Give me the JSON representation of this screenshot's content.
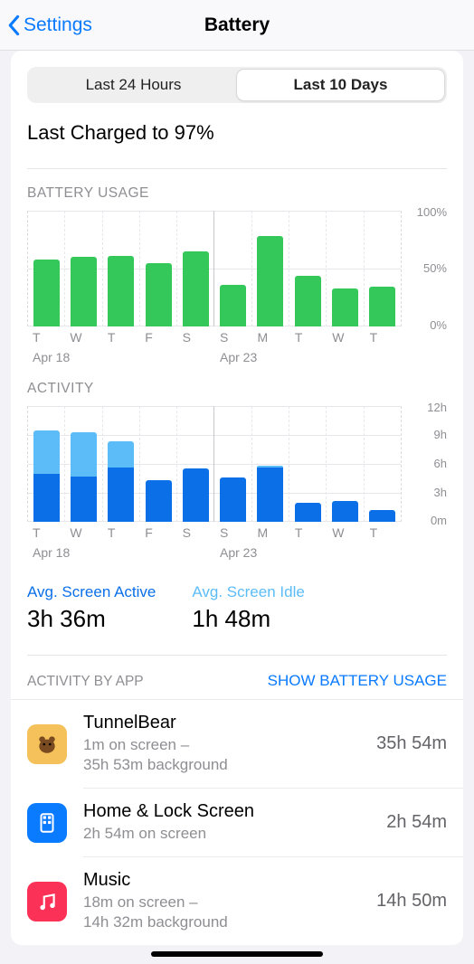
{
  "nav": {
    "back": "Settings",
    "title": "Battery"
  },
  "segmented": {
    "left": "Last 24 Hours",
    "right": "Last 10 Days",
    "active": "right"
  },
  "last_charged": "Last Charged to 97%",
  "section_labels": {
    "battery_usage": "BATTERY USAGE",
    "activity": "ACTIVITY",
    "activity_by_app": "ACTIVITY BY APP"
  },
  "battery_usage_chart": {
    "yaxis": [
      "100%",
      "50%",
      "0%"
    ],
    "xlabels": [
      "T",
      "W",
      "T",
      "F",
      "S",
      "S",
      "M",
      "T",
      "W",
      "T"
    ],
    "date_a": "Apr 18",
    "date_b": "Apr 23"
  },
  "activity_chart": {
    "yaxis": [
      "12h",
      "9h",
      "6h",
      "3h",
      "0m"
    ],
    "xlabels": [
      "T",
      "W",
      "T",
      "F",
      "S",
      "S",
      "M",
      "T",
      "W",
      "T"
    ],
    "date_a": "Apr 18",
    "date_b": "Apr 23"
  },
  "stats": {
    "active_label": "Avg. Screen Active",
    "active_value": "3h 36m",
    "idle_label": "Avg. Screen Idle",
    "idle_value": "1h 48m"
  },
  "show_battery_usage": "SHOW BATTERY USAGE",
  "apps": [
    {
      "name": "TunnelBear",
      "sub": "1m on screen –\n35h 53m background",
      "time": "35h 54m",
      "icon_bg": "#f4c15a",
      "icon_key": "bear"
    },
    {
      "name": "Home & Lock Screen",
      "sub": "2h 54m on screen",
      "time": "2h 54m",
      "icon_bg": "#0a7aff",
      "icon_key": "home"
    },
    {
      "name": "Music",
      "sub": "18m on screen –\n14h 32m background",
      "time": "14h 50m",
      "icon_bg": "#fc3158",
      "icon_key": "music"
    }
  ],
  "chart_data": [
    {
      "type": "bar",
      "title": "BATTERY USAGE",
      "categories": [
        "T",
        "W",
        "T",
        "F",
        "S",
        "S",
        "M",
        "T",
        "W",
        "T"
      ],
      "values": [
        58,
        60,
        61,
        55,
        65,
        36,
        78,
        44,
        33,
        34
      ],
      "ylabel": "%",
      "ylim": [
        0,
        100
      ],
      "x_annotations": {
        "0": "Apr 18",
        "5": "Apr 23"
      }
    },
    {
      "type": "bar",
      "title": "ACTIVITY",
      "categories": [
        "T",
        "W",
        "T",
        "F",
        "S",
        "S",
        "M",
        "T",
        "W",
        "T"
      ],
      "series": [
        {
          "name": "Screen Active",
          "values": [
            5.0,
            4.7,
            5.6,
            4.3,
            5.5,
            4.6,
            5.6,
            2.0,
            2.2,
            1.2
          ]
        },
        {
          "name": "Screen Idle",
          "values": [
            4.5,
            4.6,
            2.7,
            0.0,
            0.0,
            0.0,
            0.2,
            0.0,
            0.0,
            0.0
          ]
        }
      ],
      "ylabel": "hours",
      "ylim": [
        0,
        12
      ],
      "x_annotations": {
        "0": "Apr 18",
        "5": "Apr 23"
      }
    }
  ]
}
